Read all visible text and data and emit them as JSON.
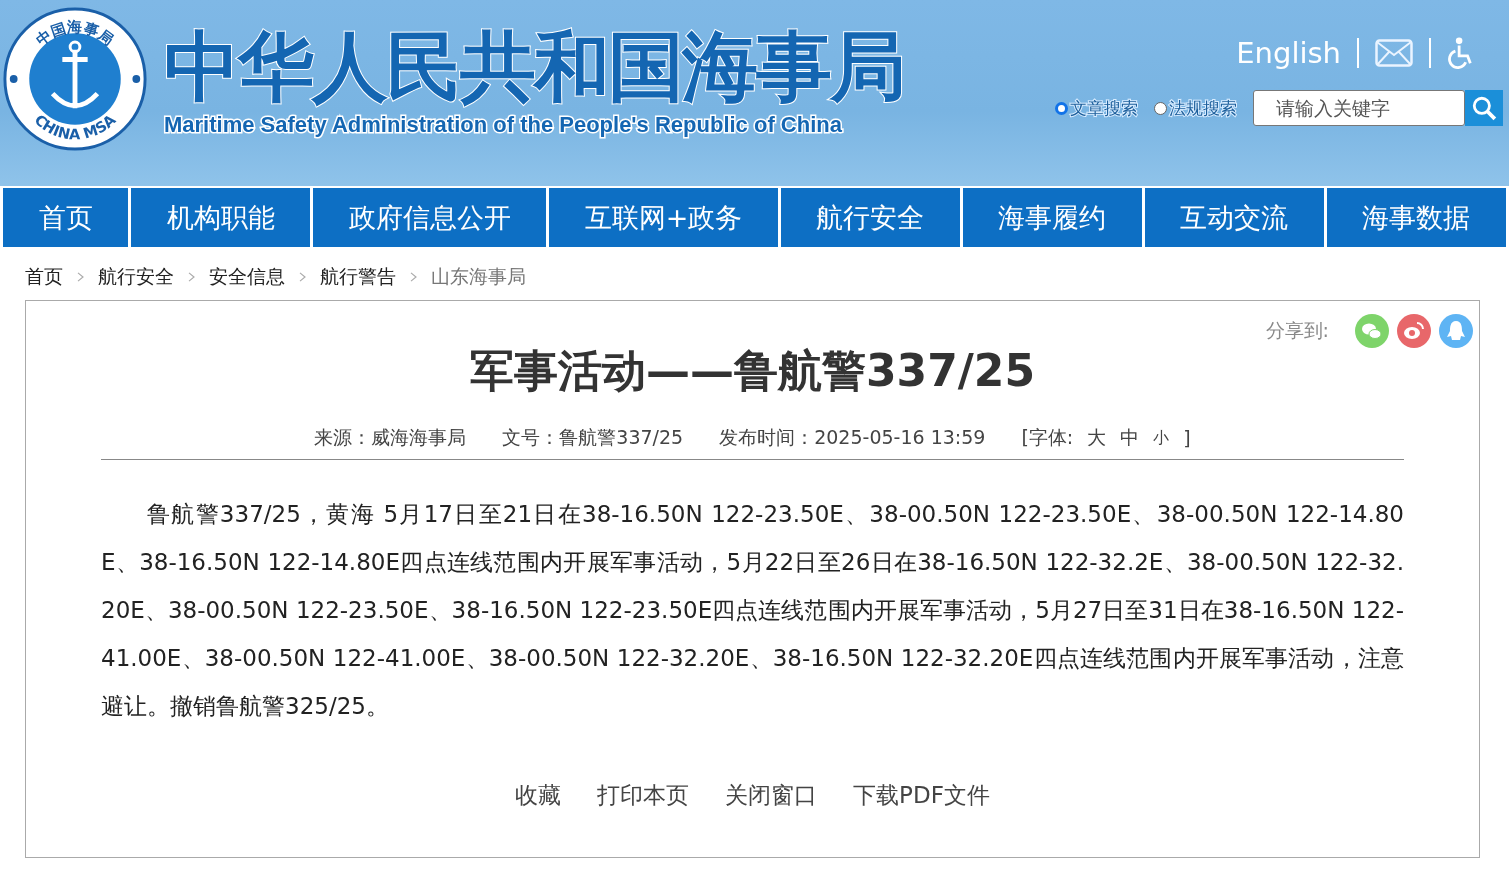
{
  "header": {
    "logo_top": "中国海事局",
    "logo_bottom": "CHINA MSA",
    "title": "中华人民共和国海事局",
    "subtitle": "Maritime Safety Administration of the People's Republic of China",
    "english_link": "English",
    "search_options": [
      {
        "label": "文章搜索",
        "selected": true
      },
      {
        "label": "法规搜索",
        "selected": false
      }
    ],
    "search": {
      "placeholder": "请输入关键字"
    }
  },
  "nav": [
    "首页",
    "机构职能",
    "政府信息公开",
    "互联网+政务",
    "航行安全",
    "海事履约",
    "互动交流",
    "海事数据"
  ],
  "breadcrumb": [
    {
      "label": "首页",
      "current": false
    },
    {
      "label": "航行安全",
      "current": false
    },
    {
      "label": "安全信息",
      "current": false
    },
    {
      "label": "航行警告",
      "current": false
    },
    {
      "label": "山东海事局",
      "current": true
    }
  ],
  "article": {
    "share_label": "分享到:",
    "title": "军事活动——鲁航警337/25",
    "meta": [
      "来源：威海海事局",
      "文号：鲁航警337/25",
      "发布时间：2025-05-16 13:59"
    ],
    "font_size": {
      "label": "[字体:",
      "options": [
        "大",
        "中",
        "小"
      ],
      "close": "]"
    },
    "body": "鲁航警337/25，黄海 5月17日至21日在38-16.50N 122-23.50E、38-00.50N 122-23.50E、38-00.50N 122-14.80E、38-16.50N 122-14.80E四点连线范围内开展军事活动，5月22日至26日在38-16.50N 122-32.2E、38-00.50N 122-32.20E、38-00.50N 122-23.50E、38-16.50N 122-23.50E四点连线范围内开展军事活动，5月27日至31日在38-16.50N 122-41.00E、38-00.50N 122-41.00E、38-00.50N 122-32.20E、38-16.50N 122-32.20E四点连线范围内开展军事活动，注意避让。撤销鲁航警325/25。",
    "actions": [
      "收藏",
      "打印本页",
      "关闭窗口",
      "下载PDF文件"
    ]
  }
}
